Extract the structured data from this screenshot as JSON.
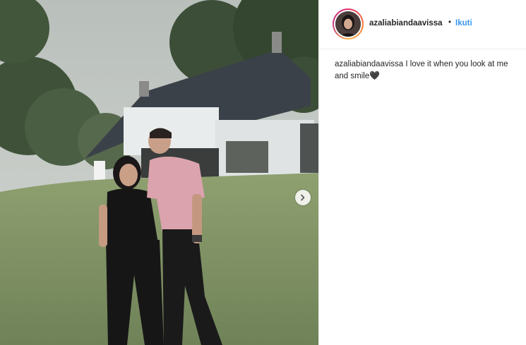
{
  "post": {
    "username": "azaliabiandaavissa",
    "separator": "•",
    "follow_label": "Ikuti",
    "caption": {
      "username": "azaliabiandaavissa",
      "text": "I love it when you look at me and smile",
      "emoji": "🖤"
    }
  },
  "icons": {
    "next": "chevron-right-icon",
    "emoji": "black-heart-icon"
  },
  "colors": {
    "follow_blue": "#3897f0",
    "text": "#262626",
    "story_ring_start": "#e1306c",
    "story_ring_end": "#fcaf45"
  }
}
